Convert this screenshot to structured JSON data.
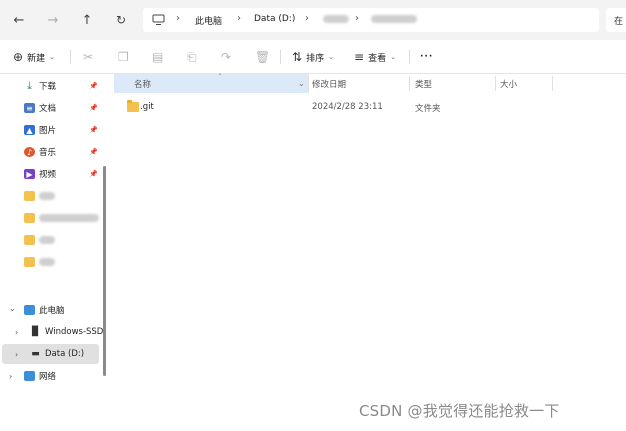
{
  "nav": {
    "back_icon": "arrow-left-icon",
    "forward_icon": "arrow-right-icon",
    "up_icon": "arrow-up-icon",
    "refresh_icon": "refresh-icon"
  },
  "address": {
    "breadcrumb": [
      "此电脑",
      "Data (D:)"
    ],
    "search_placeholder": "在"
  },
  "toolbar": {
    "new_label": "新建",
    "sort_label": "排序",
    "view_label": "查看",
    "more_label": "···"
  },
  "sidebar": {
    "quick_access": [
      {
        "label": "下载",
        "icon": "download-icon",
        "color": "#2e8b57"
      },
      {
        "label": "文档",
        "icon": "document-icon",
        "color": "#4a78c2"
      },
      {
        "label": "图片",
        "icon": "pictures-icon",
        "color": "#2f6fd6"
      },
      {
        "label": "音乐",
        "icon": "music-icon",
        "color": "#e0582e"
      },
      {
        "label": "视频",
        "icon": "video-icon",
        "color": "#7a3fc6"
      }
    ],
    "this_pc_label": "此电脑",
    "drive_c_label": "Windows-SSD",
    "drive_d_label": "Data (D:)",
    "network_label": "网络"
  },
  "columns": {
    "name": "名称",
    "modified": "修改日期",
    "type": "类型",
    "size": "大小"
  },
  "files": [
    {
      "name": ".git",
      "modified": "2024/2/28 23:11",
      "type": "文件夹",
      "size": ""
    }
  ],
  "watermark": "CSDN @我觉得还能抢救一下"
}
